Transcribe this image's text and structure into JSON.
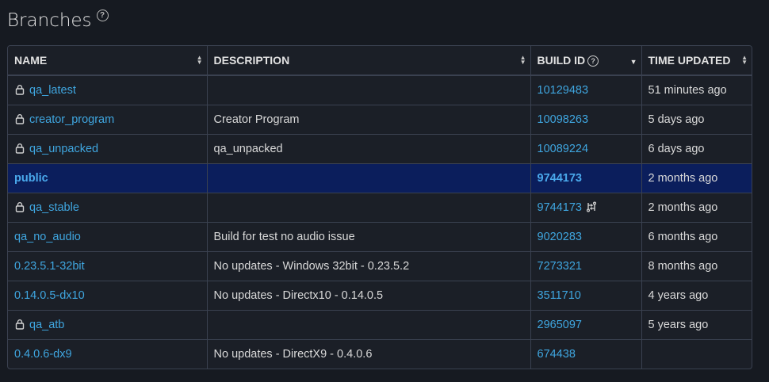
{
  "page": {
    "title": "Branches"
  },
  "table": {
    "headers": {
      "name": "NAME",
      "description": "DESCRIPTION",
      "build_id": "BUILD ID",
      "time_updated": "TIME UPDATED"
    },
    "rows": [
      {
        "name": "qa_latest",
        "locked": true,
        "description": "",
        "build_id": "10129483",
        "time_updated": "51 minutes ago"
      },
      {
        "name": "creator_program",
        "locked": true,
        "description": "Creator Program",
        "build_id": "10098263",
        "time_updated": "5 days ago"
      },
      {
        "name": "qa_unpacked",
        "locked": true,
        "description": "qa_unpacked",
        "build_id": "10089224",
        "time_updated": "6 days ago"
      },
      {
        "name": "public",
        "locked": false,
        "description": "",
        "build_id": "9744173",
        "time_updated": "2 months ago"
      },
      {
        "name": "qa_stable",
        "locked": true,
        "description": "",
        "build_id": "9744173",
        "time_updated": "2 months ago"
      },
      {
        "name": "qa_no_audio",
        "locked": false,
        "description": "Build for test no audio issue",
        "build_id": "9020283",
        "time_updated": "6 months ago"
      },
      {
        "name": "0.23.5.1-32bit",
        "locked": false,
        "description": "No updates - Windows 32bit - 0.23.5.2",
        "build_id": "7273321",
        "time_updated": "8 months ago"
      },
      {
        "name": "0.14.0.5-dx10",
        "locked": false,
        "description": "No updates - Directx10 - 0.14.0.5",
        "build_id": "3511710",
        "time_updated": "4 years ago"
      },
      {
        "name": "qa_atb",
        "locked": true,
        "description": "",
        "build_id": "2965097",
        "time_updated": "5 years ago"
      },
      {
        "name": "0.4.0.6-dx9",
        "locked": false,
        "description": "No updates - DirectX9 - 0.4.0.6",
        "build_id": "674438",
        "time_updated": ""
      }
    ]
  },
  "colors": {
    "background": "#161a21",
    "link": "#3fa6e0",
    "highlight_row": "#0b1e5c",
    "border": "#3a4150"
  },
  "icons": {
    "help": "question-circle-icon",
    "lock": "lock-icon",
    "sort": "sort-icon",
    "sync": "sync-icon"
  }
}
